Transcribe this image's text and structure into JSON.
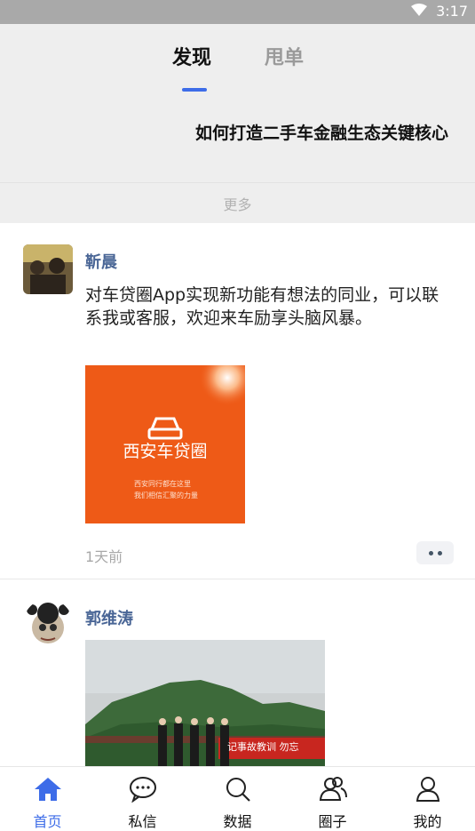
{
  "status_bar": {
    "time": "3:17",
    "wifi_icon": "wifi-icon"
  },
  "tabs": [
    {
      "label": "发现",
      "active": true
    },
    {
      "label": "甩单",
      "active": false
    }
  ],
  "headline": "如何打造二手车金融生态关键核心",
  "more_label": "更多",
  "posts": [
    {
      "author": "靳晨",
      "text": "对车贷圈App实现新功能有想法的同业，可以联系我或客服，欢迎来车励享头脑风暴。",
      "image": {
        "title": "西安车贷圈",
        "line1": "西安同行都在这里",
        "line2": "我们相信汇聚的力量",
        "bg_color": "#ee5a17"
      },
      "time": "1天前"
    },
    {
      "author": "郭维涛",
      "banner_text": "记事故教训 勿忘"
    }
  ],
  "bottom_nav": [
    {
      "label": "首页",
      "icon": "home-icon",
      "active": true
    },
    {
      "label": "私信",
      "icon": "chat-icon",
      "active": false
    },
    {
      "label": "数据",
      "icon": "search-icon",
      "active": false
    },
    {
      "label": "圈子",
      "icon": "group-icon",
      "active": false
    },
    {
      "label": "我的",
      "icon": "profile-icon",
      "active": false
    }
  ],
  "colors": {
    "accent": "#3d6ce8",
    "author": "#4a6696",
    "status_bar": "#a9a9a9"
  }
}
